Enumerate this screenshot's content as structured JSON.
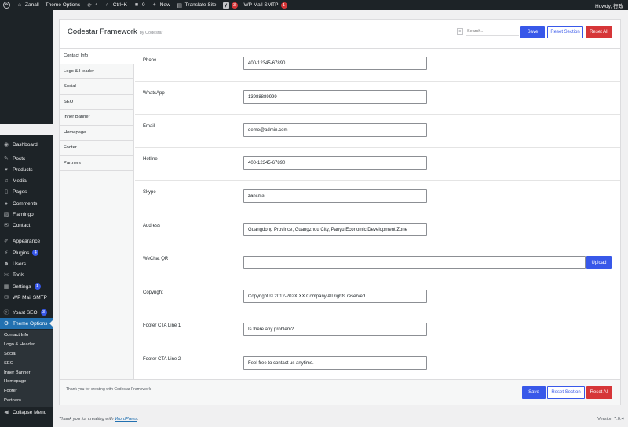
{
  "admin_bar": {
    "site_name": "Zanall",
    "theme_options": "Theme Options",
    "updates_count": "4",
    "shortcut": "Ctrl+K",
    "comments_count": "0",
    "new_label": "New",
    "translate": "Translate Site",
    "yoast_count": "3",
    "smtp": "WP Mail SMTP",
    "smtp_count": "1",
    "howdy": "Howdy, 行政"
  },
  "sidebar": {
    "items": [
      {
        "label": "Dashboard",
        "icon": "dashboard-icon"
      },
      {
        "label": "Posts",
        "icon": "pin-icon"
      },
      {
        "label": "Products",
        "icon": "cart-icon"
      },
      {
        "label": "Media",
        "icon": "media-icon"
      },
      {
        "label": "Pages",
        "icon": "pages-icon"
      },
      {
        "label": "Comments",
        "icon": "comment-icon"
      },
      {
        "label": "Flamingo",
        "icon": "flamingo-icon"
      },
      {
        "label": "Contact",
        "icon": "mail-icon"
      },
      {
        "label": "Appearance",
        "icon": "brush-icon"
      },
      {
        "label": "Plugins",
        "icon": "plug-icon",
        "badge": "4"
      },
      {
        "label": "Users",
        "icon": "user-icon"
      },
      {
        "label": "Tools",
        "icon": "wrench-icon"
      },
      {
        "label": "Settings",
        "icon": "settings-icon",
        "badge": "1"
      },
      {
        "label": "WP Mail SMTP",
        "icon": "smtp-icon"
      },
      {
        "label": "Yoast SEO",
        "icon": "yoast-icon",
        "badge": "3"
      },
      {
        "label": "Theme Options",
        "icon": "gear-icon"
      }
    ],
    "submenu": [
      "Contact Info",
      "Logo & Header",
      "Social",
      "SEO",
      "Inner Banner",
      "Homepage",
      "Footer",
      "Partners"
    ],
    "collapse": "Collapse Menu"
  },
  "panel": {
    "title": "Codestar Framework",
    "subtitle": "by Codestar",
    "search_placeholder": "Search...",
    "save": "Save",
    "reset_section": "Reset Section",
    "reset_all": "Reset All",
    "footer_note": "Thank you for creating with Codestar Framework"
  },
  "tabs": [
    "Contact Info",
    "Logo & Header",
    "Social",
    "SEO",
    "Inner Banner",
    "Homepage",
    "Footer",
    "Partners"
  ],
  "fields": [
    {
      "label": "Phone",
      "value": "400-12345-67890"
    },
    {
      "label": "WhatsApp",
      "value": "13988889999"
    },
    {
      "label": "Email",
      "value": "demo@admin.com"
    },
    {
      "label": "Hotline",
      "value": "400-12345-67890"
    },
    {
      "label": "Skype",
      "value": "zancms"
    },
    {
      "label": "Address",
      "value": "Guangdong Province, Guangzhou City, Panyu Economic Development Zone"
    },
    {
      "label": "WeChat QR",
      "value": "",
      "button": "Upload"
    },
    {
      "label": "Copyright",
      "value": "Copyright © 2012-202X XX Company All rights reserved"
    },
    {
      "label": "Footer CTA Line 1",
      "value": "Is there any problem?"
    },
    {
      "label": "Footer CTA Line 2",
      "value": "Feel free to contact us anytime."
    }
  ],
  "footer": {
    "thanks_prefix": "Thank you for creating with",
    "thanks_link": "WordPress",
    "thanks_suffix": ".",
    "version": "Version 7.0.4"
  },
  "colors": {
    "primary": "#3858e9",
    "danger": "#d63638",
    "admin_dark": "#1d2327",
    "menu_current": "#2271b1"
  }
}
